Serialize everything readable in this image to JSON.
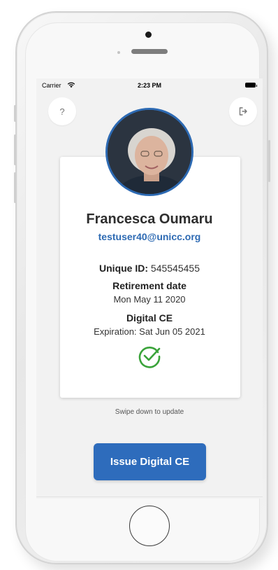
{
  "status_bar": {
    "carrier": "Carrier",
    "time": "2:23 PM"
  },
  "header": {
    "help_label": "?",
    "logout_icon": "logout-icon"
  },
  "profile": {
    "name": "Francesca Oumaru",
    "email": "testuser40@unicc.org",
    "unique_id_label": "Unique ID:",
    "unique_id_value": "545545455",
    "retirement_label": "Retirement date",
    "retirement_date": "Mon May 11 2020",
    "ce_label": "Digital CE",
    "ce_expiration": "Expiration: Sat Jun 05 2021",
    "status_icon": "check-circle-icon"
  },
  "hint": "Swipe down to update",
  "actions": {
    "issue_label": "Issue Digital CE"
  },
  "colors": {
    "accent": "#2e6cbc",
    "success": "#3aa33a",
    "background": "#f2f2f2"
  }
}
